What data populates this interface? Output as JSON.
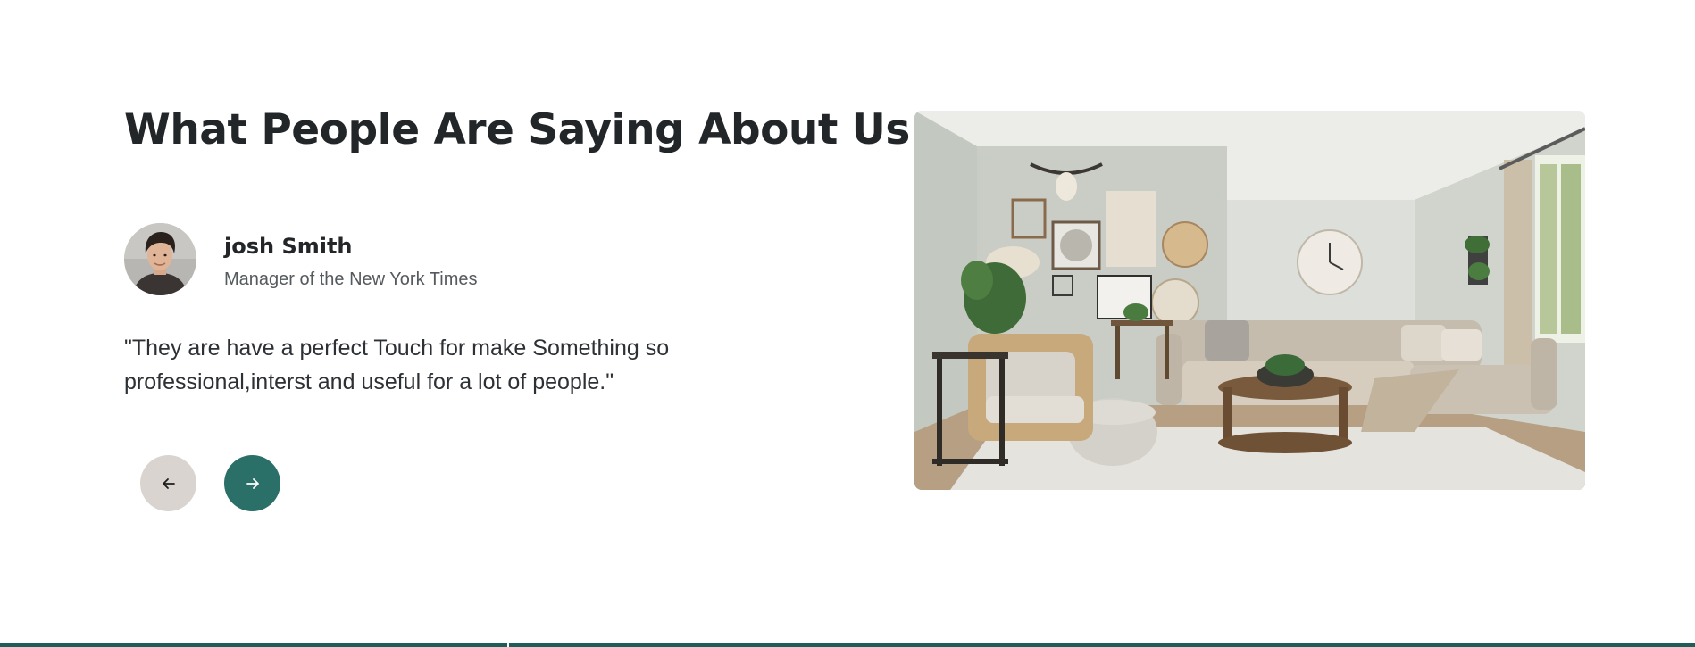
{
  "testimonials": {
    "heading": "What People Are Saying About Us",
    "author": {
      "name": "josh Smith",
      "role": "Manager of the New York Times",
      "avatar_icon": "person-avatar"
    },
    "quote": "\"They are have a perfect Touch for make Something so professional,interst and useful for a lot of people.\"",
    "controls": {
      "prev_icon": "arrow-left-icon",
      "next_icon": "arrow-right-icon",
      "prev_color": "#d9d4cf",
      "next_color": "#2a7068"
    },
    "image": {
      "subject": "living-room-interior"
    }
  },
  "theme": {
    "text": "#222629",
    "accent": "#2a7068",
    "footer_bar": "#1f5e58"
  }
}
